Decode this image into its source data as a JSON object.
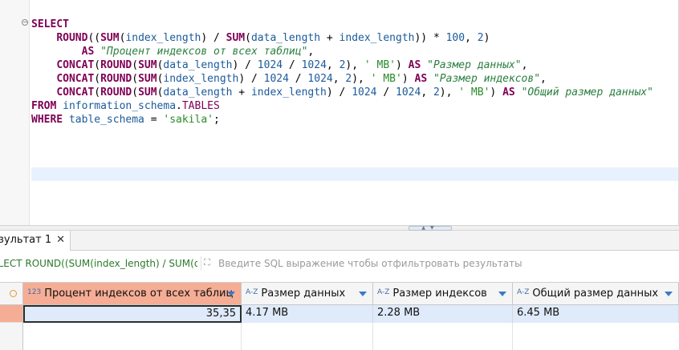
{
  "editor": {
    "lines": [
      [
        {
          "t": "SELECT",
          "c": "kw"
        }
      ],
      [
        {
          "t": "    ",
          "c": "punct"
        },
        {
          "t": "ROUND",
          "c": "fn"
        },
        {
          "t": "((",
          "c": "punct"
        },
        {
          "t": "SUM",
          "c": "fn"
        },
        {
          "t": "(",
          "c": "punct"
        },
        {
          "t": "index_length",
          "c": "id"
        },
        {
          "t": ") / ",
          "c": "punct"
        },
        {
          "t": "SUM",
          "c": "fn"
        },
        {
          "t": "(",
          "c": "punct"
        },
        {
          "t": "data_length",
          "c": "id"
        },
        {
          "t": " + ",
          "c": "punct"
        },
        {
          "t": "index_length",
          "c": "id"
        },
        {
          "t": ")) * ",
          "c": "punct"
        },
        {
          "t": "100",
          "c": "num"
        },
        {
          "t": ", ",
          "c": "punct"
        },
        {
          "t": "2",
          "c": "num"
        },
        {
          "t": ")",
          "c": "punct"
        }
      ],
      [
        {
          "t": "        ",
          "c": "punct"
        },
        {
          "t": "AS",
          "c": "kw"
        },
        {
          "t": " ",
          "c": "punct"
        },
        {
          "t": "\"Процент индексов от всех таблиц\"",
          "c": "alias"
        },
        {
          "t": ",",
          "c": "punct"
        }
      ],
      [
        {
          "t": "    ",
          "c": "punct"
        },
        {
          "t": "CONCAT",
          "c": "fn"
        },
        {
          "t": "(",
          "c": "punct"
        },
        {
          "t": "ROUND",
          "c": "fn"
        },
        {
          "t": "(",
          "c": "punct"
        },
        {
          "t": "SUM",
          "c": "fn"
        },
        {
          "t": "(",
          "c": "punct"
        },
        {
          "t": "data_length",
          "c": "id"
        },
        {
          "t": ") / ",
          "c": "punct"
        },
        {
          "t": "1024",
          "c": "num"
        },
        {
          "t": " / ",
          "c": "punct"
        },
        {
          "t": "1024",
          "c": "num"
        },
        {
          "t": ", ",
          "c": "punct"
        },
        {
          "t": "2",
          "c": "num"
        },
        {
          "t": "), ",
          "c": "punct"
        },
        {
          "t": "' MB'",
          "c": "str"
        },
        {
          "t": ") ",
          "c": "punct"
        },
        {
          "t": "AS",
          "c": "kw"
        },
        {
          "t": " ",
          "c": "punct"
        },
        {
          "t": "\"Размер данных\"",
          "c": "alias"
        },
        {
          "t": ",",
          "c": "punct"
        }
      ],
      [
        {
          "t": "    ",
          "c": "punct"
        },
        {
          "t": "CONCAT",
          "c": "fn"
        },
        {
          "t": "(",
          "c": "punct"
        },
        {
          "t": "ROUND",
          "c": "fn"
        },
        {
          "t": "(",
          "c": "punct"
        },
        {
          "t": "SUM",
          "c": "fn"
        },
        {
          "t": "(",
          "c": "punct"
        },
        {
          "t": "index_length",
          "c": "id"
        },
        {
          "t": ") / ",
          "c": "punct"
        },
        {
          "t": "1024",
          "c": "num"
        },
        {
          "t": " / ",
          "c": "punct"
        },
        {
          "t": "1024",
          "c": "num"
        },
        {
          "t": ", ",
          "c": "punct"
        },
        {
          "t": "2",
          "c": "num"
        },
        {
          "t": "), ",
          "c": "punct"
        },
        {
          "t": "' MB'",
          "c": "str"
        },
        {
          "t": ") ",
          "c": "punct"
        },
        {
          "t": "AS",
          "c": "kw"
        },
        {
          "t": " ",
          "c": "punct"
        },
        {
          "t": "\"Размер индексов\"",
          "c": "alias"
        },
        {
          "t": ",",
          "c": "punct"
        }
      ],
      [
        {
          "t": "    ",
          "c": "punct"
        },
        {
          "t": "CONCAT",
          "c": "fn"
        },
        {
          "t": "(",
          "c": "punct"
        },
        {
          "t": "ROUND",
          "c": "fn"
        },
        {
          "t": "(",
          "c": "punct"
        },
        {
          "t": "SUM",
          "c": "fn"
        },
        {
          "t": "(",
          "c": "punct"
        },
        {
          "t": "data_length",
          "c": "id"
        },
        {
          "t": " + ",
          "c": "punct"
        },
        {
          "t": "index_length",
          "c": "id"
        },
        {
          "t": ") / ",
          "c": "punct"
        },
        {
          "t": "1024",
          "c": "num"
        },
        {
          "t": " / ",
          "c": "punct"
        },
        {
          "t": "1024",
          "c": "num"
        },
        {
          "t": ", ",
          "c": "punct"
        },
        {
          "t": "2",
          "c": "num"
        },
        {
          "t": "), ",
          "c": "punct"
        },
        {
          "t": "' MB'",
          "c": "str"
        },
        {
          "t": ") ",
          "c": "punct"
        },
        {
          "t": "AS",
          "c": "kw"
        },
        {
          "t": " ",
          "c": "punct"
        },
        {
          "t": "\"Общий размер данных\"",
          "c": "alias"
        }
      ],
      [
        {
          "t": "FROM",
          "c": "kw"
        },
        {
          "t": " ",
          "c": "punct"
        },
        {
          "t": "information_schema",
          "c": "id"
        },
        {
          "t": ".",
          "c": "punct"
        },
        {
          "t": "TABLES",
          "c": "tbl"
        }
      ],
      [
        {
          "t": "WHERE",
          "c": "kw"
        },
        {
          "t": " ",
          "c": "punct"
        },
        {
          "t": "table_schema",
          "c": "id"
        },
        {
          "t": " = ",
          "c": "punct"
        },
        {
          "t": "'sakila'",
          "c": "str"
        },
        {
          "t": ";",
          "c": "punct"
        }
      ]
    ]
  },
  "results": {
    "tab_label": "зультат 1",
    "tab_close": "✕",
    "query_preview": "ELECT ROUND((SUM(index_length) / SUM(dat",
    "filter_placeholder": "Введите SQL выражение чтобы отфильтровать результаты",
    "columns": [
      {
        "type_icon": "123",
        "label": "Процент индексов от всех таблиц",
        "selected": true
      },
      {
        "type_icon": "A-Z",
        "label": "Размер данных",
        "selected": false
      },
      {
        "type_icon": "A-Z",
        "label": "Размер индексов",
        "selected": false
      },
      {
        "type_icon": "A-Z",
        "label": "Общий размер данных",
        "selected": false
      }
    ],
    "rows": [
      [
        "35,35",
        "4.17 MB",
        "2.28 MB",
        "6.45 MB"
      ]
    ]
  },
  "colors": {
    "keyword": "#7f0055",
    "selected_header": "#f5ad95",
    "row_highlight": "#dfeafa"
  }
}
